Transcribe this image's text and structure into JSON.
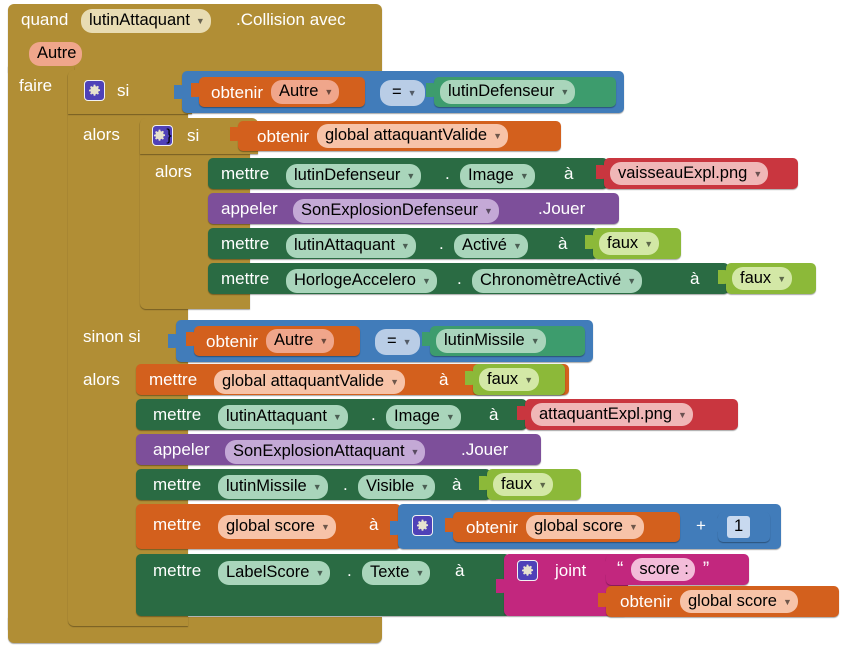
{
  "workspace": {
    "language": "fr",
    "palette": {
      "event": "#b18e35",
      "control": "#b18e35",
      "setter": "#2a6b43",
      "variable": "#d3601d",
      "logic": "#8cb939",
      "math": "#417cba",
      "procedure_call": "#7d4f9a",
      "asset": "#c9363f",
      "component": "#3d9c6d",
      "text": "#c2277e",
      "mutator_gear": "#4f41b8"
    }
  },
  "event_block": {
    "keyword": "quand",
    "component": "lutinAttaquant",
    "event_name": ".Collision avec",
    "parameter": "Autre",
    "body_label": "faire"
  },
  "outer_if": {
    "if_label": "si",
    "then_label": "alors",
    "else_if_label": "sinon si",
    "else_if_then_label": "alors",
    "condition": {
      "get_label": "obtenir",
      "get_value": "Autre",
      "operator": "=",
      "right_component": "lutinDefenseur"
    },
    "else_if_condition": {
      "get_label": "obtenir",
      "get_value": "Autre",
      "operator": "=",
      "right_component": "lutinMissile"
    }
  },
  "inner_if": {
    "if_label": "si",
    "then_label": "alors",
    "condition": {
      "get_label": "obtenir",
      "get_value": "global attaquantValide"
    },
    "statements": [
      {
        "kind": "setter",
        "set_label": "mettre",
        "component": "lutinDefenseur",
        "property": "Image",
        "to_label": "à",
        "value_kind": "asset",
        "value": "vaisseauExpl.png"
      },
      {
        "kind": "call",
        "call_label": "appeler",
        "component": "SonExplosionDefenseur",
        "method": ".Jouer"
      },
      {
        "kind": "setter",
        "set_label": "mettre",
        "component": "lutinAttaquant",
        "property": "Activé",
        "to_label": "à",
        "value_kind": "logic",
        "value": "faux"
      },
      {
        "kind": "setter",
        "set_label": "mettre",
        "component": "HorlogeAccelero",
        "property": "ChronomètreActivé",
        "to_label": "à",
        "value_kind": "logic",
        "value": "faux"
      }
    ]
  },
  "else_if_body": {
    "set_global_valide": {
      "set_label": "mettre",
      "variable": "global attaquantValide",
      "to_label": "à",
      "value": "faux"
    },
    "set_attaquant_image": {
      "set_label": "mettre",
      "component": "lutinAttaquant",
      "property": "Image",
      "to_label": "à",
      "value": "attaquantExpl.png"
    },
    "call_son": {
      "call_label": "appeler",
      "component": "SonExplosionAttaquant",
      "method": ".Jouer"
    },
    "set_missile_visible": {
      "set_label": "mettre",
      "component": "lutinMissile",
      "property": "Visible",
      "to_label": "à",
      "value": "faux"
    },
    "set_score": {
      "set_label": "mettre",
      "variable": "global score",
      "to_label": "à",
      "math": {
        "get_label": "obtenir",
        "get_value": "global score",
        "operator": "+",
        "number": "1"
      }
    },
    "set_label_score": {
      "set_label": "mettre",
      "component": "LabelScore",
      "property": "Texte",
      "to_label": "à",
      "join": {
        "join_label": "joint",
        "open_quote": "“",
        "close_quote": "”",
        "text_value": "score : ",
        "second": {
          "get_label": "obtenir",
          "get_value": "global score"
        }
      }
    }
  },
  "icons": {
    "mutator": "gear-icon",
    "dropdown": "chevron-down-icon"
  }
}
